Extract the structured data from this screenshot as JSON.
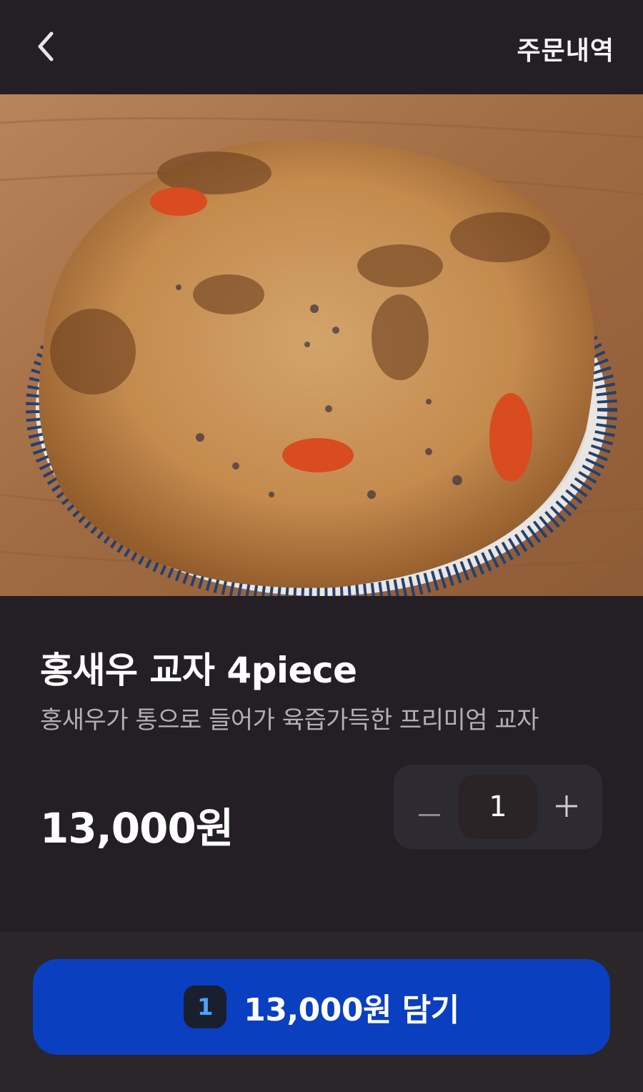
{
  "header": {
    "back_icon": "chevron-left-icon",
    "order_history_label": "주문내역"
  },
  "product": {
    "image_alt": "홍새우 교자 4piece",
    "title": "홍새우 교자 4piece",
    "description": "홍새우가 통으로 들어가 육즙가득한 프리미엄 교자",
    "price": "13,000원"
  },
  "stepper": {
    "minus_icon": "minus-icon",
    "quantity": "1",
    "plus_icon": "plus-icon"
  },
  "cart_button": {
    "count": "1",
    "label": "13,000원 담기"
  },
  "colors": {
    "background": "#231f24",
    "accent_button": "#0a3fc0",
    "badge_text": "#4aa3ff"
  }
}
